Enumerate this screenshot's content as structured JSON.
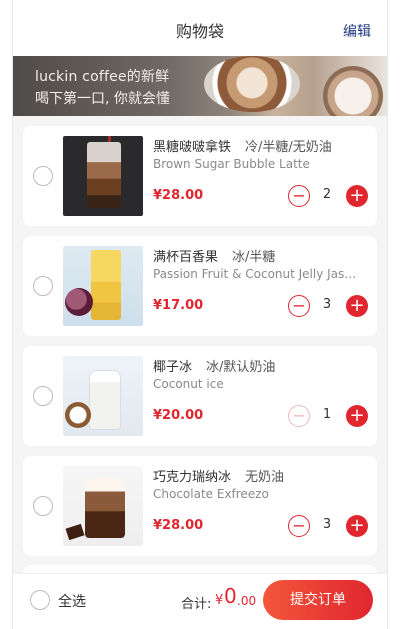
{
  "header": {
    "title": "购物袋",
    "edit_label": "编辑"
  },
  "banner": {
    "line1": "luckin coffee的新鲜",
    "line2": "喝下第一口, 你就会懂"
  },
  "items": [
    {
      "name_cn": "黑糖啵啵拿铁",
      "options": "冷/半糖/无奶油",
      "name_en": "Brown Sugar Bubble Latte",
      "price": "¥28.00",
      "qty": "2",
      "minus_enabled": true
    },
    {
      "name_cn": "满杯百香果",
      "options": "冰/半糖",
      "name_en": "Passion Fruit & Coconut Jelly Jasmine Tea",
      "price": "¥17.00",
      "qty": "3",
      "minus_enabled": true
    },
    {
      "name_cn": "椰子冰",
      "options": "冰/默认奶油",
      "name_en": "Coconut ice",
      "price": "¥20.00",
      "qty": "1",
      "minus_enabled": false
    },
    {
      "name_cn": "巧克力瑞纳冰",
      "options": "无奶油",
      "name_en": "Chocolate Exfreezo",
      "price": "¥28.00",
      "qty": "3",
      "minus_enabled": true
    }
  ],
  "footer": {
    "select_all": "全选",
    "total_label": "合计:",
    "currency": "¥",
    "total_int": "0",
    "total_dec": ".00",
    "submit_label": "提交订单"
  },
  "icons": {
    "minus": "−",
    "plus": "+"
  },
  "colors": {
    "accent": "#e0262f",
    "edit": "#1f3b7f"
  }
}
